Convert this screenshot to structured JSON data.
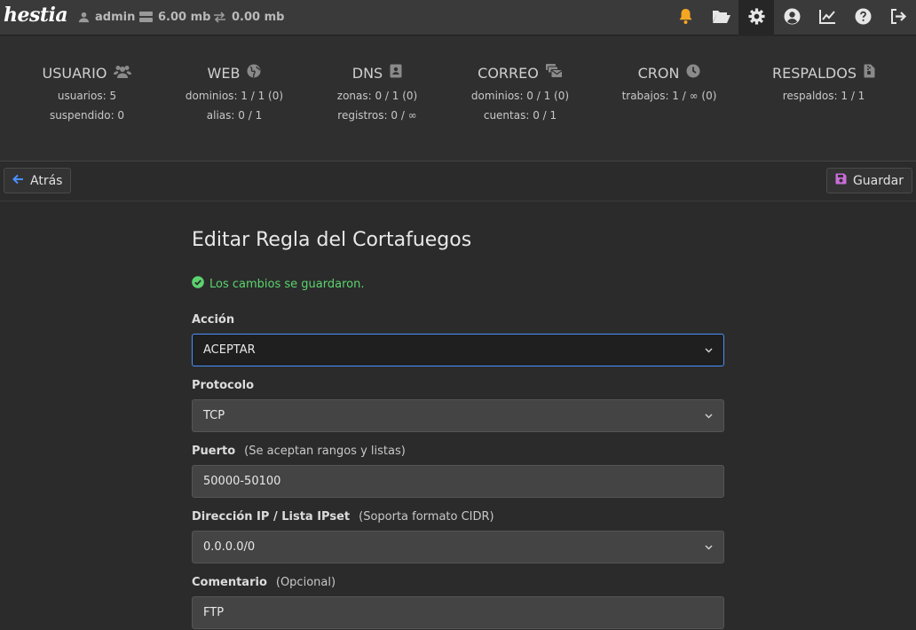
{
  "topbar": {
    "logo": "hestia",
    "user": "admin",
    "disk": "6.00 mb",
    "bandwidth": "0.00 mb"
  },
  "stats": [
    {
      "title": "USUARIO",
      "lines": [
        "usuarios: 5",
        "suspendido: 0"
      ]
    },
    {
      "title": "WEB",
      "lines": [
        "dominios: 1 / 1 (0)",
        "alias: 0 / 1"
      ]
    },
    {
      "title": "DNS",
      "lines": [
        "zonas: 0 / 1 (0)",
        "registros: 0 / ∞"
      ]
    },
    {
      "title": "CORREO",
      "lines": [
        "dominios: 0 / 1 (0)",
        "cuentas: 0 / 1"
      ]
    },
    {
      "title": "CRON",
      "lines": [
        "trabajos: 1 / ∞ (0)"
      ]
    },
    {
      "title": "RESPALDOS",
      "lines": [
        "respaldos: 1 / 1"
      ]
    }
  ],
  "toolbar": {
    "back_label": "Atrás",
    "save_label": "Guardar"
  },
  "form": {
    "title": "Editar Regla del Cortafuegos",
    "success_message": "Los cambios se guardaron.",
    "action": {
      "label": "Acción",
      "value": "ACEPTAR"
    },
    "protocol": {
      "label": "Protocolo",
      "value": "TCP"
    },
    "port": {
      "label": "Puerto",
      "hint": "(Se aceptan rangos y listas)",
      "value": "50000-50100"
    },
    "ip": {
      "label": "Dirección IP / Lista IPset",
      "hint": "(Soporta formato CIDR)",
      "value": "0.0.0.0/0"
    },
    "comment": {
      "label": "Comentario",
      "hint": "(Opcional)",
      "value": "FTP"
    }
  },
  "colors": {
    "bell": "#f5a623",
    "success": "#5bd36f",
    "back_arrow": "#4a90ff",
    "save_icon": "#c86dd7"
  }
}
